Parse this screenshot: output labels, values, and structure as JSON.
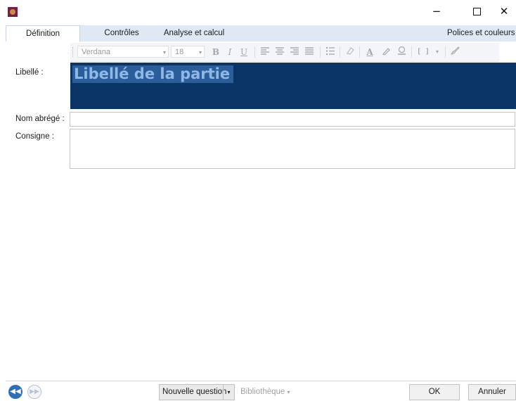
{
  "window": {
    "minimize": "−",
    "close": "✕"
  },
  "tabs": [
    {
      "label": "Définition",
      "active": true
    },
    {
      "label": "Contrôles",
      "active": false
    },
    {
      "label": "Analyse et calcul",
      "active": false
    },
    {
      "label": "Polices et couleurs",
      "active": false
    }
  ],
  "toolbar": {
    "font": "Verdana",
    "size": "18",
    "bold": "B",
    "italic": "I",
    "underline": "U",
    "font_color": "A",
    "brackets": "[ ]",
    "dropdown_arrow": "▾",
    "icons": [
      "align-left-icon",
      "align-center-icon",
      "align-right-icon",
      "justify-icon",
      "bullet-list-icon",
      "clear-format-icon",
      "font-color-icon",
      "highlight-icon",
      "fill-icon",
      "brackets-icon",
      "paint-brush-icon"
    ]
  },
  "form": {
    "libelle_label": "Libellé :",
    "libelle_value": "Libellé de la partie",
    "nom_abrege_label": "Nom abrégé :",
    "nom_abrege_value": "",
    "consigne_label": "Consigne :",
    "consigne_value": ""
  },
  "footer": {
    "prev": "◀◀",
    "next": "▶▶",
    "nouvelle_question": "Nouvelle question",
    "bibliotheque": "Bibliothèque",
    "dropdown_arrow": "▾",
    "ok": "OK",
    "annuler": "Annuler"
  },
  "colors": {
    "libelle_background": "#0b3466",
    "libelle_text": "#8fb8e6",
    "tab_strip": "#dfe9f5",
    "nav_button": "#2f6fb5"
  }
}
